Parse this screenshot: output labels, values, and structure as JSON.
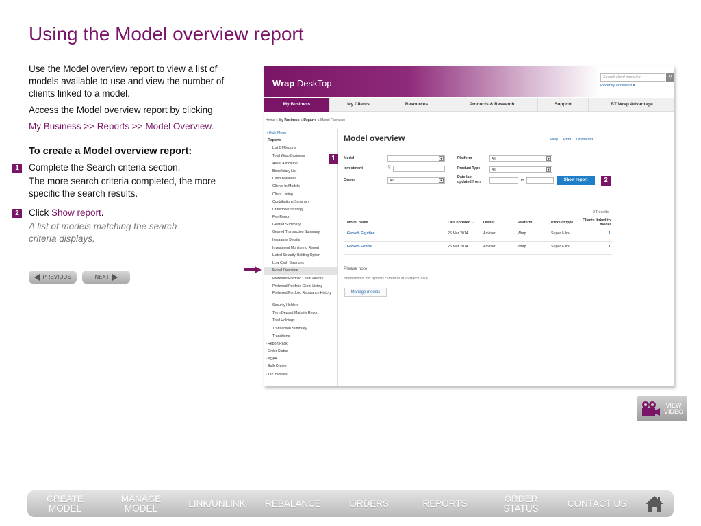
{
  "page": {
    "title": "Using the Model overview report"
  },
  "intro": {
    "p1": "Use the Model overview report to view a list of models available to use and view the number of clients linked to a model.",
    "p2": "Access the Model overview report by clicking",
    "path": "My Business >> Reports >> Model Overview.",
    "heading": "To create a Model overview report:",
    "step1_num": "1",
    "step1_text": "Complete the Search criteria section.",
    "step1_sub": "The more search criteria completed, the more specific the search results.",
    "step2_num": "2",
    "step2_prefix": "Click ",
    "step2_link": "Show report",
    "step2_suffix": ".",
    "step2_result": "A list of models matching the search criteria displays."
  },
  "nav_buttons": {
    "previous": "PREVIOUS",
    "next": "NEXT"
  },
  "app": {
    "logo_bold": "Wrap",
    "logo_rest": " DeskTop",
    "search_placeholder": "Search client name/no",
    "recently_accessed": "Recently accessed ▾",
    "nav": [
      "My Business",
      "My Clients",
      "Resources",
      "Products & Research",
      "Support",
      "BT Wrap Advantage"
    ],
    "breadcrumb": {
      "home": "Home",
      "my_business": "My Business",
      "reports": "Reports",
      "current": "Model Overview",
      "sep": " > "
    },
    "sidebar": {
      "hide_menu": "‹‹ Hide Menu",
      "reports": "- Reports",
      "report_items": [
        "List Of Reports",
        "Total Wrap Business",
        "Asset Allocation",
        "Beneficiary List",
        "Cash Balances",
        "Clients In Models",
        "Client Listing",
        "Contributions Summary",
        "Drawdown Strategy",
        "Fee Report",
        "Geared Summary",
        "Geared Transaction Summary",
        "Insurance Details",
        "Investment Monitoring Report",
        "Listed Security Holding Option",
        "Low Cash Balances",
        "Model Overview",
        "Preferred Portfolio Client History",
        "Preferred Portfolio Client Listing",
        "Preferred Portfolio Rebalance History",
        "Security Holders",
        "Term Deposit Maturity Report",
        "Total Holdings",
        "Transaction Summary",
        "Transitions"
      ],
      "categories": [
        "› Report Pack",
        "› Order Status",
        "› FOFA",
        "› Bulk Orders",
        "› Tax Invoices"
      ]
    },
    "main": {
      "title": "Model overview",
      "tools": [
        "Help",
        "Print",
        "Download"
      ],
      "form": {
        "model_label": "Model",
        "investment_label": "Investment",
        "owner_label": "Owner",
        "owner_value": "All",
        "platform_label": "Platform",
        "platform_value": "All",
        "product_type_label": "Product Type",
        "product_type_value": "All",
        "date_label": "Date last updated from",
        "to_label": "to",
        "show_report": "Show report"
      },
      "callout_1": "1",
      "callout_2": "2",
      "results_count": "2 Results",
      "columns": [
        "Model name",
        "Last updated ⌄",
        "Owner",
        "Platform",
        "Product type",
        "Clients linked to model"
      ],
      "rows": [
        [
          "Growth Equities",
          "25 Mar 2014",
          "Adviser",
          "Wrap",
          "Super & Inv...",
          "1"
        ],
        [
          "Growth Funds",
          "25 Mar 2014",
          "Adviser",
          "Wrap",
          "Super & Inv...",
          "1"
        ]
      ],
      "note_heading": "Please note",
      "note_text": "Information in this report is current as at 26 March 2014",
      "manage_models": "Manage models"
    }
  },
  "video": {
    "label_line1": "VIEW",
    "label_line2": "VIDEO"
  },
  "bottom_nav": [
    {
      "line1": "CREATE",
      "line2": "MODEL"
    },
    {
      "line1": "MANAGE",
      "line2": "MODEL"
    },
    {
      "line1": "LINK/UNLINK",
      "line2": ""
    },
    {
      "line1": "REBALANCE",
      "line2": ""
    },
    {
      "line1": "ORDERS",
      "line2": ""
    },
    {
      "line1": "REPORTS",
      "line2": ""
    },
    {
      "line1": "ORDER",
      "line2": "STATUS"
    },
    {
      "line1": "CONTACT US",
      "line2": ""
    }
  ],
  "colors": {
    "brand": "#7a1466",
    "link": "#2b6cb0",
    "button_blue": "#1e7fc8"
  },
  "icons": {
    "home": "home-icon",
    "video": "video-camera-icon",
    "arrow": "pointer-arrow-icon"
  }
}
